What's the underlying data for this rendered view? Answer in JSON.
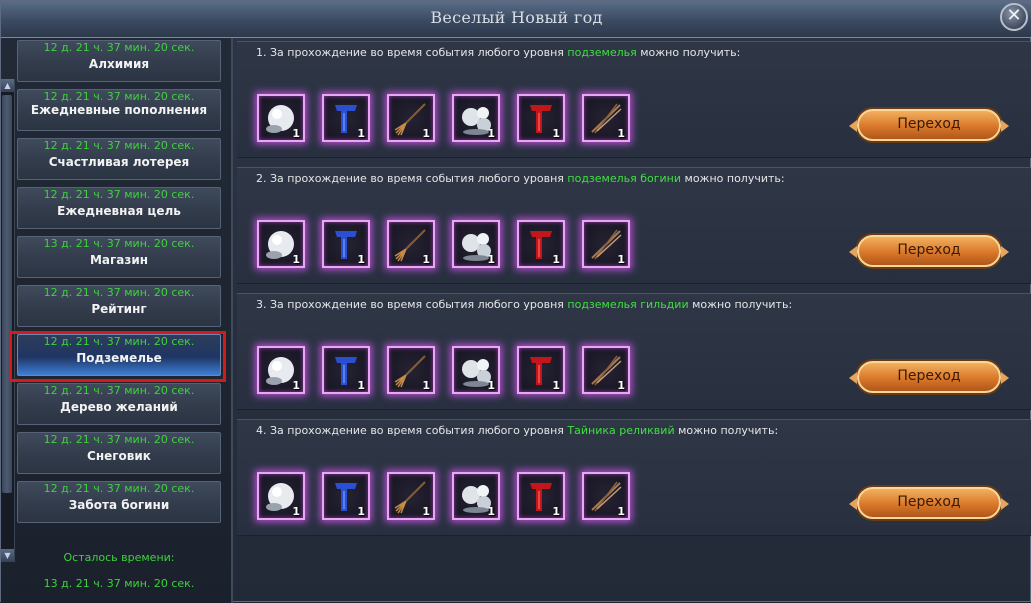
{
  "window": {
    "title": "Веселый Новый год",
    "close_symbol": "✕"
  },
  "sidebar": {
    "items": [
      {
        "timer": "12 д. 21 ч. 37 мин. 20 сек.",
        "label": "Алхимия"
      },
      {
        "timer": "12 д. 21 ч. 37 мин. 20 сек.",
        "label": "Ежедневные пополнения"
      },
      {
        "timer": "12 д. 21 ч. 37 мин. 20 сек.",
        "label": "Счастливая лотерея"
      },
      {
        "timer": "12 д. 21 ч. 37 мин. 20 сек.",
        "label": "Ежедневная цель"
      },
      {
        "timer": "13 д. 21 ч. 37 мин. 20 сек.",
        "label": "Магазин"
      },
      {
        "timer": "12 д. 21 ч. 37 мин. 20 сек.",
        "label": "Рейтинг"
      },
      {
        "timer": "12 д. 21 ч. 37 мин. 20 сек.",
        "label": "Подземелье"
      },
      {
        "timer": "12 д. 21 ч. 37 мин. 20 сек.",
        "label": "Дерево желаний"
      },
      {
        "timer": "12 д. 21 ч. 37 мин. 20 сек.",
        "label": "Снеговик"
      },
      {
        "timer": "12 д. 21 ч. 37 мин. 20 сек.",
        "label": "Забота богини"
      }
    ],
    "selected": "Подземелье",
    "remaining_label": "Осталось времени:",
    "remaining_value": "13 д. 21 ч. 37 мин. 20 сек.",
    "scroll_up": "▲",
    "scroll_down": "▼"
  },
  "tasks": [
    {
      "prefix": "1. За прохождение во время события любого уровня ",
      "highlight": "подземелья",
      "suffix": " можно получить:",
      "button": "Переход"
    },
    {
      "prefix": "2. За прохождение во время события любого уровня ",
      "highlight": "подземелья богини",
      "suffix": " можно получить:",
      "button": "Переход"
    },
    {
      "prefix": "3. За прохождение во время события любого уровня ",
      "highlight": "подземелья гильдии",
      "suffix": " можно получить:",
      "button": "Переход"
    },
    {
      "prefix": "4. За прохождение во время события любого уровня ",
      "highlight": "Тайника реликвий",
      "suffix": " можно получить:",
      "button": "Переход"
    }
  ],
  "rewards": [
    {
      "icon": "snowball-icon",
      "qty": "1"
    },
    {
      "icon": "blue-scarf-icon",
      "qty": "1"
    },
    {
      "icon": "broom-icon",
      "qty": "1"
    },
    {
      "icon": "snowballs-pile-icon",
      "qty": "1"
    },
    {
      "icon": "red-scarf-icon",
      "qty": "1"
    },
    {
      "icon": "twigs-icon",
      "qty": "1"
    }
  ],
  "colors": {
    "highlight_green": "#3ee03e",
    "timer_green": "#3ed23e",
    "reward_glow": "#b24fd0",
    "selected_outline": "#d41a1a",
    "button_orange": "#d9782a"
  }
}
